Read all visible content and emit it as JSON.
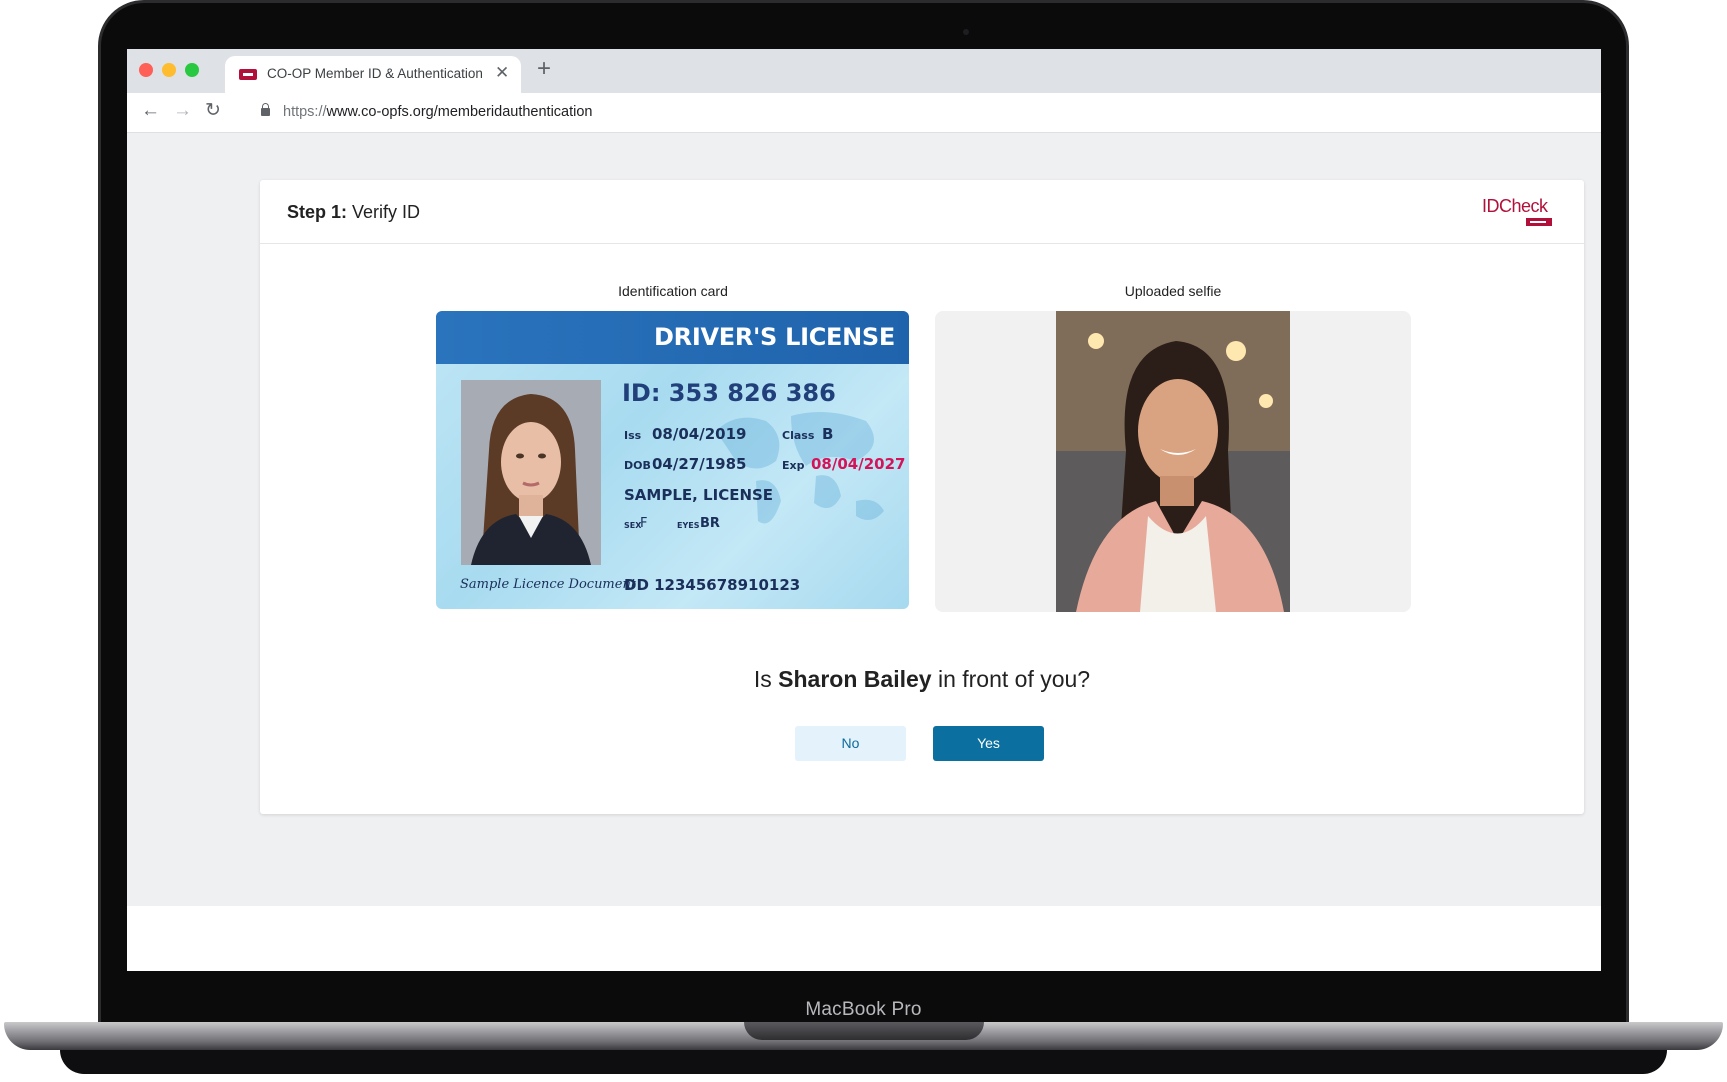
{
  "device": {
    "label": "MacBook Pro"
  },
  "browser": {
    "tab_title": "CO-OP Member ID & Authentication",
    "url_scheme": "https://",
    "url_rest": "www.co-opfs.org/memberidauthentication",
    "colors": {
      "close": "#ff5f57",
      "minimize": "#febc2e",
      "maximize": "#28c840"
    }
  },
  "header": {
    "step_label": "Step 1:",
    "step_title": "Verify ID",
    "logo_text": "IDCheck"
  },
  "id_panel": {
    "caption": "Identification card",
    "card": {
      "title": "DRIVER'S LICENSE",
      "id_number": "ID: 353 826 386",
      "iss_label": "Iss",
      "iss_value": "08/04/2019",
      "class_label": "Class",
      "class_value": "B",
      "dob_label": "DOB",
      "dob_value": "04/27/1985",
      "exp_label": "Exp",
      "exp_value": "08/04/2027",
      "name": "SAMPLE, LICENSE",
      "sex_label": "SEX",
      "sex_value": "F",
      "eyes_label": "EYES",
      "eyes_value": "BR",
      "dd": "DD 12345678910123",
      "signature": "Sample Licence Document"
    }
  },
  "selfie_panel": {
    "caption": "Uploaded selfie"
  },
  "question": {
    "pre": "Is ",
    "name": "Sharon Bailey",
    "post": " in front of you?"
  },
  "buttons": {
    "no": "No",
    "yes": "Yes"
  },
  "colors": {
    "accent": "#0b6fa0",
    "brand": "#b1103a",
    "exp_red": "#d4145a"
  }
}
